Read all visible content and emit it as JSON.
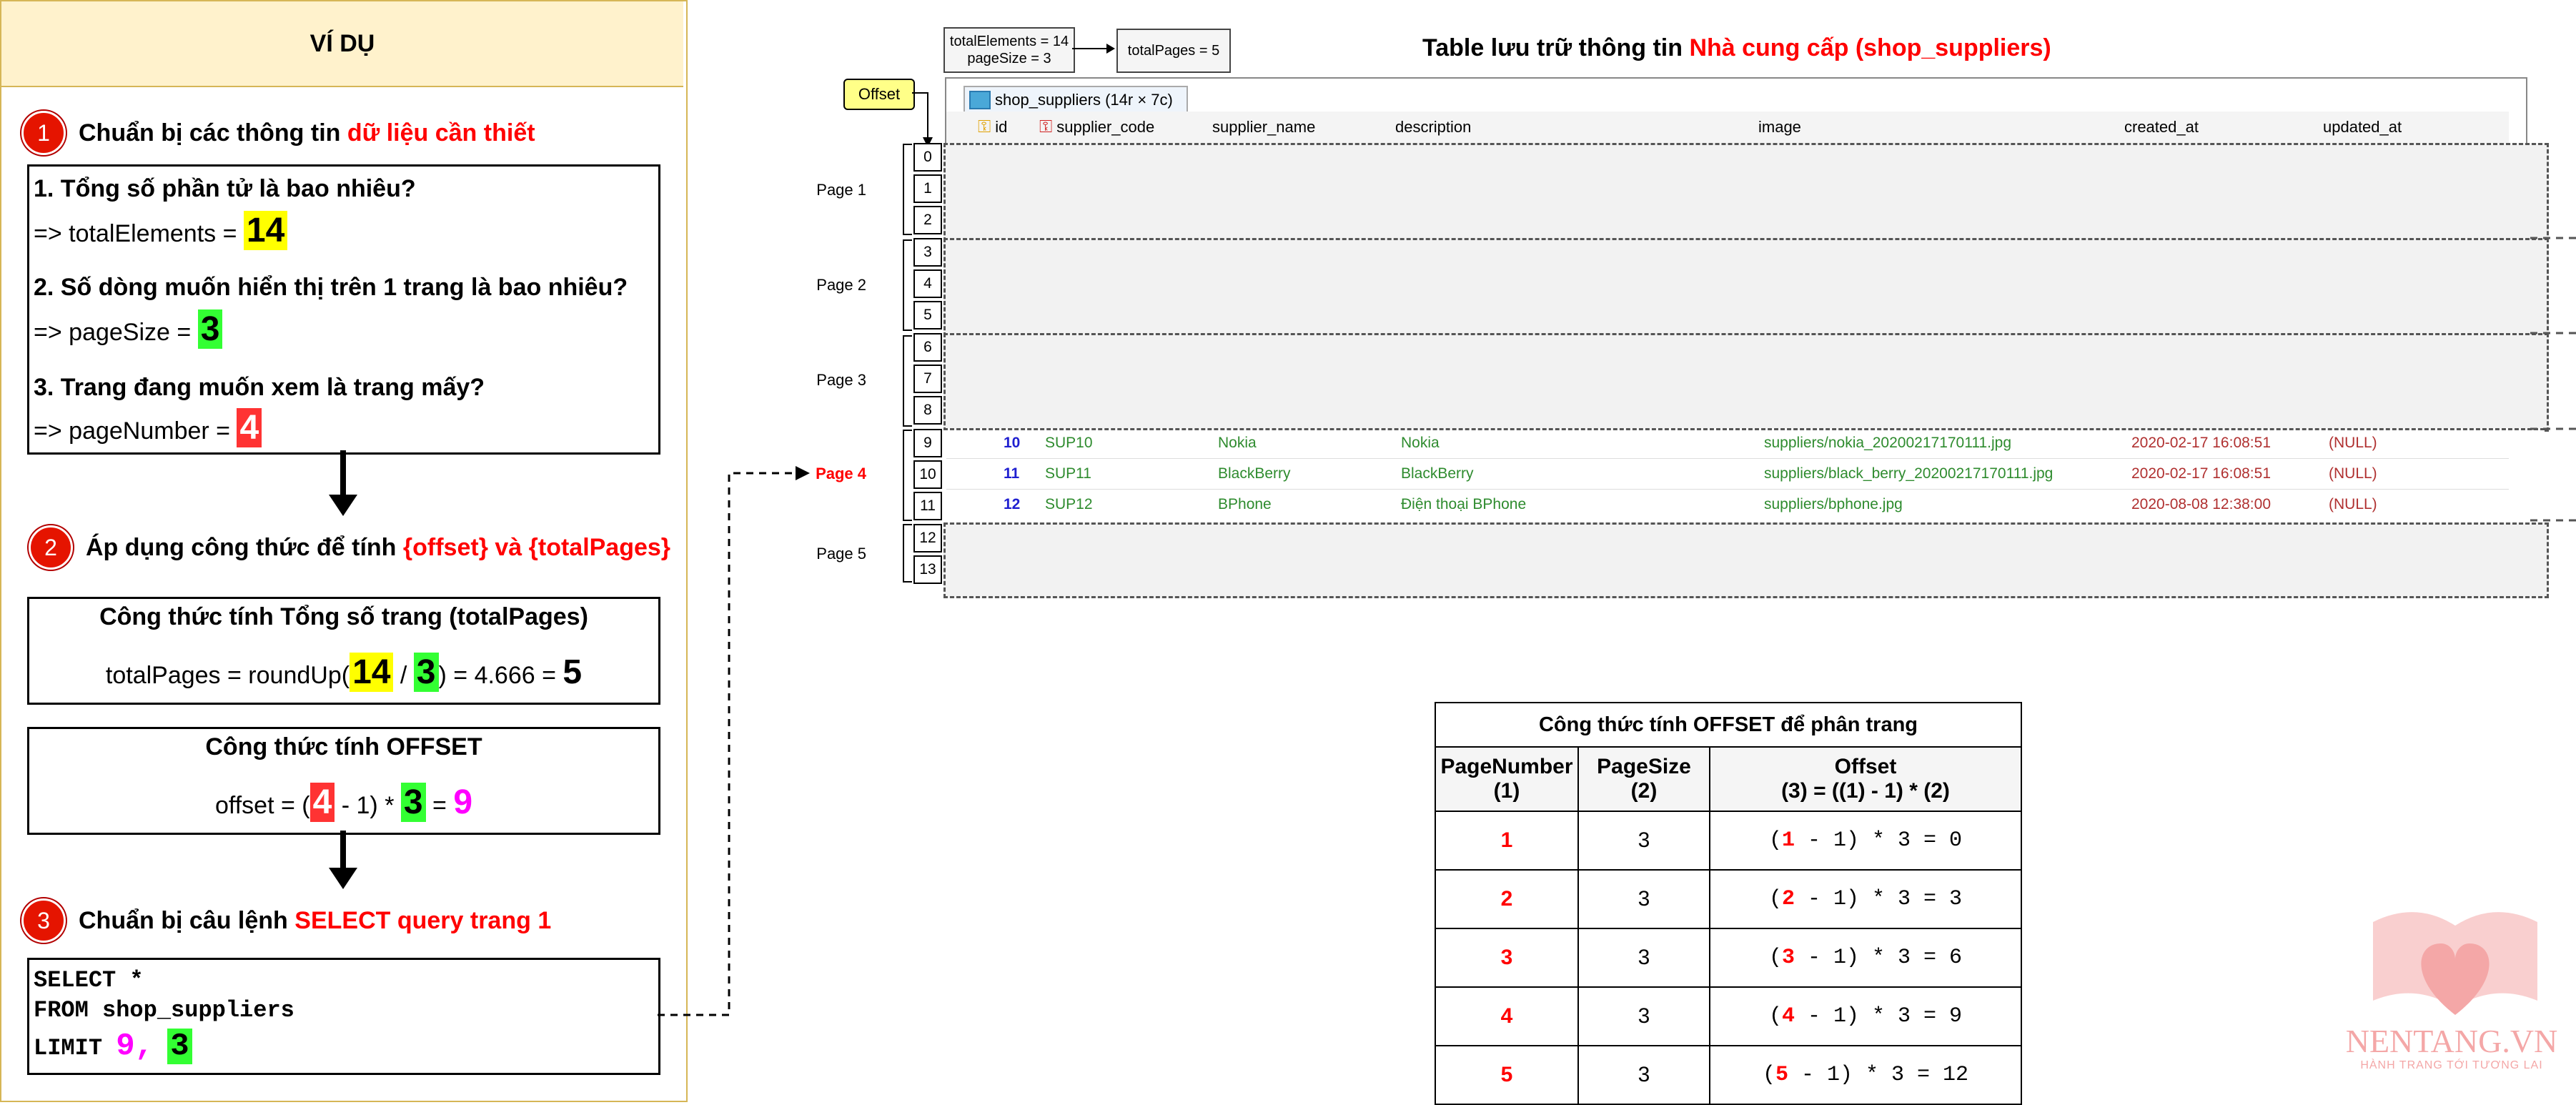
{
  "left": {
    "header": "VÍ DỤ",
    "step1": {
      "num": "1",
      "text": "Chuẩn bị các thông tin ",
      "highlight": "dữ liệu cần thiết"
    },
    "questions": [
      {
        "q": "1. Tổng số phần tử là bao nhiêu?",
        "a_prefix": "=> totalElements = ",
        "value": "14"
      },
      {
        "q": "2. Số dòng muốn hiển thị trên 1 trang là bao nhiêu?",
        "a_prefix": "=> pageSize = ",
        "value": "3"
      },
      {
        "q": "3. Trang đang muốn xem là trang mấy?",
        "a_prefix": "=> pageNumber = ",
        "value": "4"
      }
    ],
    "step2": {
      "num": "2",
      "text": "Áp dụng công thức để tính ",
      "highlight": "{offset} và {totalPages}"
    },
    "total_pages_box": {
      "title": "Công thức tính Tổng số trang (totalPages)",
      "prefix": "totalPages = roundUp(",
      "a": "14",
      "slash": " / ",
      "b": "3",
      "suffix": ") = 4.666 = ",
      "result": "5"
    },
    "offset_box": {
      "title": "Công thức tính OFFSET",
      "prefix": "offset = (",
      "a": "4",
      "mid": " - 1) * ",
      "b": "3",
      "eq": " = ",
      "result": "9"
    },
    "step3": {
      "num": "3",
      "text": "Chuẩn bị câu lệnh ",
      "highlight": "SELECT query trang 1"
    },
    "sql": {
      "line1": "SELECT *",
      "line2": "FROM shop_suppliers",
      "line3_prefix": "LIMIT ",
      "offset": "9,",
      "size": "3"
    }
  },
  "right": {
    "note_elements": "totalElements = 14\npageSize = 3",
    "note_pages": "totalPages = 5",
    "offset_label": "Offset",
    "title_prefix": "Table lưu trữ thông tin ",
    "title_highlight": "Nhà cung cấp (shop_suppliers)",
    "tab_label": "shop_suppliers (14r × 7c)",
    "columns": [
      "id",
      "supplier_code",
      "supplier_name",
      "description",
      "image",
      "created_at",
      "updated_at"
    ],
    "indices": [
      "0",
      "1",
      "2",
      "3",
      "4",
      "5",
      "6",
      "7",
      "8",
      "9",
      "10",
      "11",
      "12",
      "13"
    ],
    "pages": [
      "Page 1",
      "Page 2",
      "Page 3",
      "Page 4",
      "Page 5"
    ],
    "rows": [
      {
        "id": "10",
        "code": "SUP10",
        "name": "Nokia",
        "desc": "Nokia",
        "image": "suppliers/nokia_20200217170111.jpg",
        "created": "2020-02-17 16:08:51",
        "updated": "(NULL)"
      },
      {
        "id": "11",
        "code": "SUP11",
        "name": "BlackBerry",
        "desc": "BlackBerry",
        "image": "suppliers/black_berry_20200217170111.jpg",
        "created": "2020-02-17 16:08:51",
        "updated": "(NULL)"
      },
      {
        "id": "12",
        "code": "SUP12",
        "name": "BPhone",
        "desc": "Điện thoại BPhone",
        "image": "suppliers/bphone.jpg",
        "created": "2020-08-08 12:38:00",
        "updated": "(NULL)"
      }
    ]
  },
  "offset_table": {
    "title": "Công thức tính OFFSET để phân trang",
    "headers": [
      {
        "top": "PageNumber",
        "bottom": "(1)"
      },
      {
        "top": "PageSize",
        "bottom": "(2)"
      },
      {
        "top": "Offset",
        "bottom": "(3) = ((1) - 1) * (2)"
      }
    ],
    "rows": [
      {
        "page": "1",
        "size": "3",
        "open": "(",
        "p": "1",
        "rest": " - 1) * 3 = 0"
      },
      {
        "page": "2",
        "size": "3",
        "open": "(",
        "p": "2",
        "rest": " - 1) * 3 = 3"
      },
      {
        "page": "3",
        "size": "3",
        "open": "(",
        "p": "3",
        "rest": " - 1) * 3 = 6"
      },
      {
        "page": "4",
        "size": "3",
        "open": "(",
        "p": "4",
        "rest": " - 1) * 3 = 9"
      },
      {
        "page": "5",
        "size": "3",
        "open": "(",
        "p": "5",
        "rest": " - 1) * 3 = 12"
      }
    ]
  },
  "logo": {
    "name": "NENTANG.VN",
    "tagline": "HÀNH TRANG TỚI TƯƠNG LAI"
  },
  "colors": {
    "accent_red": "#ff0000",
    "highlight_yellow": "#ffff00",
    "highlight_green": "#33ff33",
    "magenta": "#ff00ff",
    "header_bg": "#fff2cc",
    "header_border": "#d6b656",
    "db_green": "#2e8b2e",
    "id_blue": "#1f1fd0",
    "logo_pink": "#f4a7a7"
  }
}
